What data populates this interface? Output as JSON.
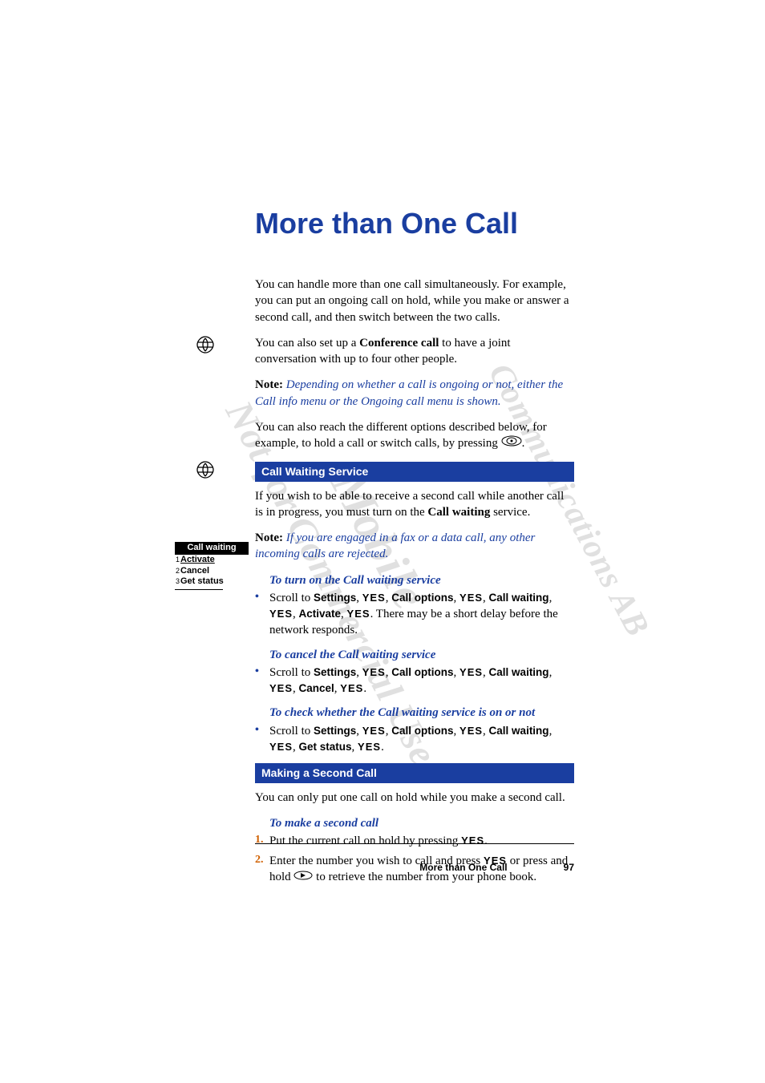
{
  "watermarks": {
    "wm1": "Mobile",
    "wm2": "Not for Commercial Use",
    "wm3": "Communications AB"
  },
  "title": "More than One Call",
  "p1a": "You can handle more than one call simultaneously. For example, you can put an ongoing call on hold, while you make or answer a second call, and then switch between the two calls.",
  "p2_pre": "You can also set up a ",
  "p2_bold": "Conference call",
  "p2_post": " to have a joint conversation with up to four other people.",
  "note1_label": "Note:",
  "note1_text": " Depending on whether a call is ongoing or not, either the Call info menu or the Ongoing call menu is shown.",
  "p3a": "You can also reach the different options described below, for example, to hold a call or switch calls, by pressing ",
  "section1": "Call Waiting Service",
  "p4_pre": "If you wish to be able to receive a second call while another call is in progress, you must turn on the ",
  "p4_bold": "Call waiting",
  "p4_post": " service.",
  "note2_label": "Note:",
  "note2_text": " If you are engaged in a fax or a data call, any other incoming calls are rejected.",
  "proc1_title": "To turn on the Call waiting service",
  "proc1_pre": "Scroll to ",
  "kw_settings": "Settings",
  "kw_yes": "YES",
  "kw_calloptions": "Call options",
  "kw_callwaiting": "Call waiting",
  "kw_activate": "Activate",
  "kw_cancel": "Cancel",
  "kw_getstatus": "Get status",
  "proc1_tail": ". There may be a short delay before the network responds.",
  "proc2_title": "To cancel the Call waiting service",
  "proc3_title": "To check whether the Call waiting service is on or not",
  "section2": "Making a Second Call",
  "p5": "You can only put one call on hold while you make a second call.",
  "proc4_title": "To make a second call",
  "step1": "Put the current call on hold by pressing ",
  "step2a": "Enter the number you wish to call and press ",
  "step2b": " or press and hold ",
  "step2c": " to retrieve the number from your phone book.",
  "sep_comma": ", ",
  "sep_period": ".",
  "screen": {
    "title": "Call waiting",
    "opt1": "Activate",
    "opt2": "Cancel",
    "opt3": "Get status",
    "num1": "1",
    "num2": "2",
    "num3": "3"
  },
  "footer_text": "More than One Call",
  "page_num": "97",
  "step_num1": "1.",
  "step_num2": "2."
}
